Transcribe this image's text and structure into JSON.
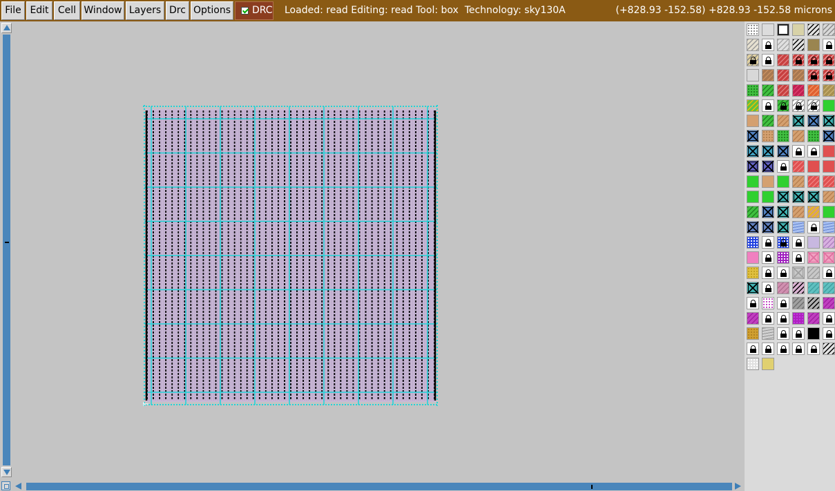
{
  "menu": [
    {
      "label": "File",
      "name": "file-menu"
    },
    {
      "label": "Edit",
      "name": "edit-menu"
    },
    {
      "label": "Cell",
      "name": "cell-menu"
    },
    {
      "label": "Window",
      "name": "window-menu"
    },
    {
      "label": "Layers",
      "name": "layers-menu"
    },
    {
      "label": "Drc",
      "name": "drc-menu"
    },
    {
      "label": "Options",
      "name": "options-menu"
    }
  ],
  "drc": {
    "label": "DRC",
    "checked": true
  },
  "status": {
    "loaded": "read",
    "editing": "read",
    "tool": "box",
    "technology": "sky130A",
    "text": "Loaded: read Editing: read Tool: box  Technology: sky130A"
  },
  "coords": "(+828.93 -152.58) +828.93 -152.58 microns",
  "colors": {
    "title_bar": "#8a5a14",
    "drc_button": "#8b3d20",
    "scrollbar": "#4a86bb",
    "canvas_bg": "#c4c4c4",
    "cell_fill": "#c9b8d6",
    "metal_grid": "#1fd4d8",
    "rails": "#000000"
  },
  "icons": [
    "arrow-up-icon",
    "arrow-down-icon",
    "arrow-left-icon",
    "arrow-right-icon",
    "zoom-box-icon",
    "lock-icon",
    "checkbox-icon"
  ],
  "palette": [
    [
      "dots|#ffffff|#888|0",
      "solid|#dcdcdc|#888|0",
      "outline|#ffffff|#222|0",
      "solid|#d8d2a8|#888|0",
      "hatch|#e0e0e0|#000|0",
      "hatch|#d8d8d8|#888|0"
    ],
    [
      "hatch|#e6e0d0|#999|0",
      "solid|#ffffff|#888|1",
      "hatch|#e0e0e0|#aaa|0",
      "hatch|#e0e0e0|#000|0",
      "solid|#9a8550|#888|0",
      "solid|#ffffff|#888|1"
    ],
    [
      "hatch|#e0d0a0|#888|1",
      "solid|#ffffff|#888|1",
      "hatch|#c84040|#e08080|0",
      "hatch|#c84040|#f0a0a0|1",
      "hatch|#c84040|#f0a0a0|1",
      "hatch|#c84040|#f0a0a0|1"
    ],
    [
      "solid|#d8d8d8|#888|0",
      "hatch|#a87850|#c89060|0",
      "hatch|#c84040|#e08080|0",
      "hatch|#a87850|#c89060|0",
      "hatch|#c84040|#f0a0a0|1",
      "hatch|#c84040|#f0a0a0|1"
    ],
    [
      "dots|#40c040|#208020|0",
      "hatch|#40c040|#208020|0",
      "hatch|#c84040|#e08080|0",
      "hatch|#c02050|#e04070|0",
      "hatch|#e06030|#f09060|0",
      "hatch|#a89050|#c8b070|0"
    ],
    [
      "hatch|#60c040|#f0c000|0",
      "solid|#ffffff|#888|1",
      "hatch|#40c040|#208020|1",
      "hatch|#ffffff|#888|1",
      "hatch|#ffffff|#888|1",
      "solid|#30d030|#888|0"
    ],
    [
      "solid|#d4a070|#888|0",
      "hatch|#40c040|#208020|0",
      "hatch|#d4a070|#b88050|0",
      "cross|#40b0b0|#000|0",
      "cross|#5080c0|#000|0",
      "cross|#40b0b0|#000|0"
    ],
    [
      "cross|#5080c0|#000|0",
      "dots|#d4a070|#b08050|0",
      "dots|#40c040|#208020|0",
      "hatch|#d4a070|#b88050|0",
      "dots|#40c040|#208020|0",
      "cross|#5080c0|#000|0"
    ],
    [
      "cross|#40a0c0|#000|0",
      "cross|#40a0c0|#000|0",
      "cross|#5080c0|#000|0",
      "solid|#ffffff|#888|1",
      "solid|#ffffff|#888|1",
      "solid|#e05050|#888|0"
    ],
    [
      "cross|#6060c0|#000|0",
      "cross|#6060c0|#000|0",
      "solid|#ffffff|#888|1",
      "hatch|#e05050|#f08080|0",
      "solid|#e05050|#888|0",
      "solid|#e05050|#888|0"
    ],
    [
      "solid|#30d030|#888|0",
      "solid|#d4a070|#888|0",
      "solid|#30d030|#888|0",
      "hatch|#d4a070|#b88050|0",
      "hatch|#e05050|#f08080|0",
      "hatch|#e05050|#f08080|0"
    ],
    [
      "solid|#30d030|#888|0",
      "solid|#30d030|#888|0",
      "cross|#40b0b0|#000|0",
      "cross|#40b0b0|#000|0",
      "cross|#40b0b0|#000|0",
      "hatch|#d4a070|#b88050|0"
    ],
    [
      "hatch|#40c040|#208020|0",
      "cross|#5080c0|#000|0",
      "cross|#40b0b0|#000|0",
      "hatch|#d4a070|#b88050|0",
      "hatch|#d4a070|#f0c000|0",
      "solid|#30d030|#888|0"
    ],
    [
      "cross|#6080c0|#000|0",
      "cross|#6080c0|#000|0",
      "cross|#40b0b0|#000|0",
      "wave|#a8c0f0|#6080d0|0",
      "solid|#ffffff|#888|1",
      "wave|#a8c0f0|#6080d0|0"
    ],
    [
      "dots|#2040e0|#ffffff|0",
      "solid|#ffffff|#888|1",
      "dots|#2040e0|#ffffff|1",
      "solid|#ffffff|#888|1",
      "solid|#c8b8e0|#888|0",
      "hatch|#d8b0e0|#b080c0|0"
    ],
    [
      "solid|#f080c0|#888|0",
      "solid|#ffffff|#888|1",
      "dots|#a020c0|#ffffff|0",
      "solid|#ffffff|#888|1",
      "cross|#f0a0c0|#e070a0|0",
      "cross|#f0a0c0|#e070a0|0"
    ],
    [
      "dots|#e0c040|#c0a020|0",
      "solid|#ffffff|#888|1",
      "solid|#ffffff|#888|1",
      "cross|#c8c8c8|#a0a0a0|0",
      "hatch|#c8c8c8|#a0a0a0|0",
      "solid|#ffffff|#888|1"
    ],
    [
      "cross|#40b0b0|#000|0",
      "solid|#ffffff|#888|1",
      "hatch|#d090b0|#b07090|0",
      "hatch|#d8b0d0|#000|0",
      "hatch|#60c0c0|#40a0a0|0",
      "hatch|#60c0c0|#40a0a0|0"
    ],
    [
      "solid|#ffffff|#888|1",
      "dots|#ffffff|#c040c0|0",
      "solid|#ffffff|#888|1",
      "hatch|#a0a0a0|#707070|0",
      "hatch|#b0b0b0|#000|0",
      "hatch|#c040c0|#a020a0|0"
    ],
    [
      "hatch|#c040c0|#a020a0|0",
      "solid|#ffffff|#888|1",
      "solid|#ffffff|#888|1",
      "dots|#b020c0|#c040e0|0",
      "hatch|#c040c0|#a020a0|0",
      "solid|#ffffff|#888|1"
    ],
    [
      "dots|#d0a030|#b08020|0",
      "wave|#d0d0d0|#909090|0",
      "solid|#ffffff|#888|1",
      "solid|#ffffff|#888|1",
      "solid|#000000|#888|0",
      "solid|#ffffff|#888|1"
    ],
    [
      "solid|#ffffff|#888|1",
      "solid|#ffffff|#888|1",
      "solid|#ffffff|#888|1",
      "solid|#ffffff|#888|1",
      "solid|#ffffff|#888|1",
      "hatch|#e0e0e0|#000|0"
    ],
    [
      "dots|#e0e0e0|#ffffff|0",
      "solid|#e0d070|#888|0"
    ]
  ]
}
